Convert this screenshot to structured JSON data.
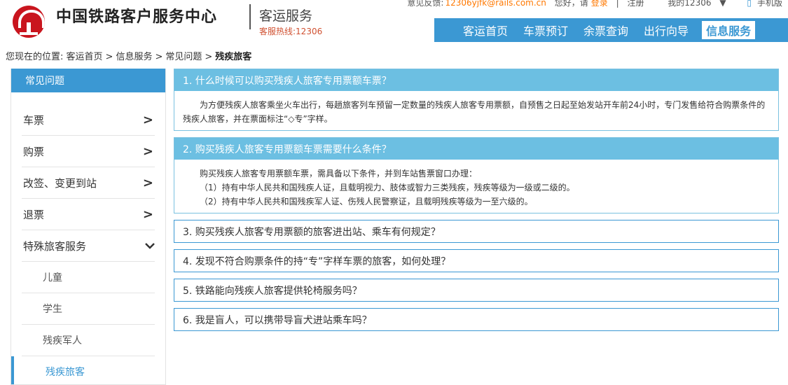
{
  "header": {
    "brand": "中国铁路客户服务中心",
    "subtitle": "客运服务",
    "hotline": "客服热线:12306",
    "topbar": {
      "feedback_label": "意见反馈:",
      "feedback_email": "12306yjfk@rails.com.cn",
      "greeting": "您好，请",
      "login": "登录",
      "divider": "|",
      "register": "注册",
      "my12306": "我的12306",
      "mobile": "手机版"
    },
    "nav": [
      {
        "label": "客运首页"
      },
      {
        "label": "车票预订"
      },
      {
        "label": "余票查询"
      },
      {
        "label": "出行向导"
      },
      {
        "label": "信息服务"
      }
    ]
  },
  "breadcrumb": {
    "prefix": "您现在的位置:",
    "items": [
      "客运首页",
      "信息服务",
      "常见问题"
    ],
    "current": "残疾旅客",
    "separator": ">"
  },
  "sidebar": {
    "title": "常见问题",
    "items": [
      {
        "label": "车票",
        "chevron": "›"
      },
      {
        "label": "购票",
        "chevron": "›"
      },
      {
        "label": "改签、变更到站",
        "chevron": "›"
      },
      {
        "label": "退票",
        "chevron": "›"
      },
      {
        "label": "特殊旅客服务",
        "chevron": "⌄"
      }
    ],
    "subitems": [
      {
        "label": "儿童"
      },
      {
        "label": "学生"
      },
      {
        "label": "残疾军人"
      },
      {
        "label": "残疾旅客"
      }
    ]
  },
  "faq": [
    {
      "question": "1. 什么时候可以购买残疾人旅客专用票额车票？",
      "answer": "为方便残疾人旅客乘坐火车出行，每趟旅客列车预留一定数量的残疾人旅客专用票额，自预售之日起至始发站开车前24小时，专门发售给符合购票条件的残疾人旅客，并在票面标注“◇专”字样。"
    },
    {
      "question": "2. 购买残疾人旅客专用票额车票需要什么条件？",
      "answer_intro": "购买残疾人旅客专用票额车票，需具备以下条件，并到车站售票窗口办理：",
      "answer_list": [
        "（1）持有中华人民共和国残疾人证，且载明视力、肢体或智力三类残疾，残疾等级为一级或二级的。",
        "（2）持有中华人民共和国残疾军人证、伤残人民警察证，且载明残疾等级为一至六级的。"
      ]
    },
    {
      "question": "3. 购买残疾人旅客专用票额的旅客进出站、乘车有何规定？"
    },
    {
      "question": "4. 发现不符合购票条件的持“专”字样车票的旅客，如何处理？"
    },
    {
      "question": "5. 铁路能向残疾人旅客提供轮椅服务吗？"
    },
    {
      "question": "6. 我是盲人，可以携带导盲犬进站乘车吗？"
    }
  ],
  "colors": {
    "accent": "#3b98d3",
    "open_question_bg": "#6cbfe2",
    "brand_red": "#c9151e",
    "highlight": "#ff7800"
  }
}
